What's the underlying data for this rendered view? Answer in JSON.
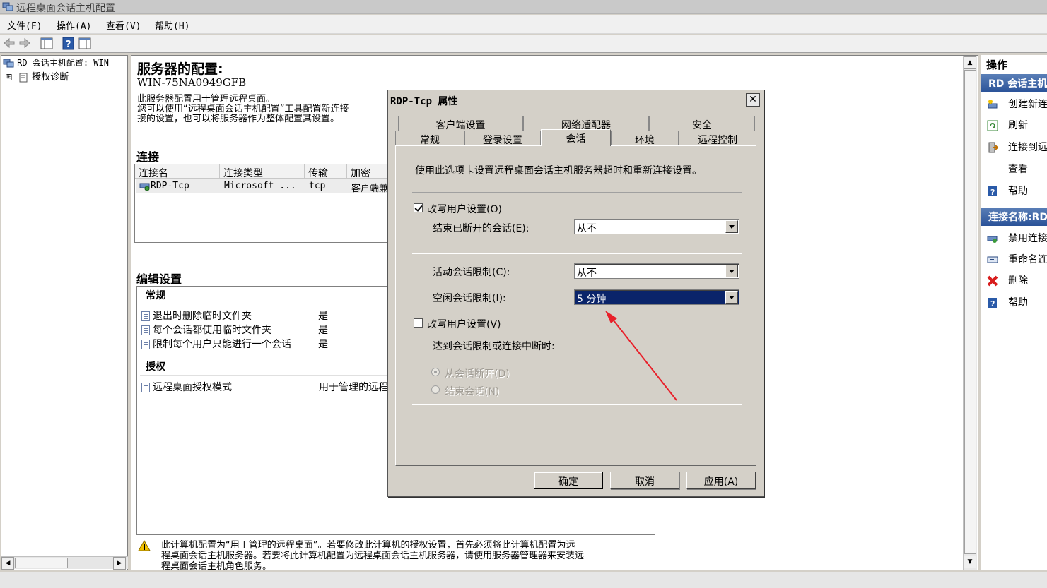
{
  "window": {
    "title": "远程桌面会话主机配置"
  },
  "menu": [
    "文件(F)",
    "操作(A)",
    "查看(V)",
    "帮助(H)"
  ],
  "tree": {
    "root": "RD 会话主机配置: WIN",
    "child": "授权诊断",
    "expander": "⊞"
  },
  "server": {
    "heading": "服务器的配置:",
    "name": "WIN-75NA0949GFB",
    "desc1": "此服务器配置用于管理远程桌面。",
    "desc2": "您可以使用“远程桌面会话主机配置”工具配置新连接",
    "desc3": "接的设置，也可以将服务器作为整体配置其设置。"
  },
  "connections": {
    "heading": "连接",
    "columns": [
      "连接名",
      "连接类型",
      "传输",
      "加密"
    ],
    "rows": [
      {
        "name": "RDP-Tcp",
        "type": "Microsoft ...",
        "transport": "tcp",
        "encryption": "客户端兼"
      }
    ]
  },
  "edit_settings": {
    "heading": "编辑设置",
    "general_heading": "常规",
    "general": [
      {
        "label": "退出时删除临时文件夹",
        "value": "是"
      },
      {
        "label": "每个会话都使用临时文件夹",
        "value": "是"
      },
      {
        "label": "限制每个用户只能进行一个会话",
        "value": "是"
      }
    ],
    "licensing_heading": "授权",
    "licensing": [
      {
        "label": "远程桌面授权模式",
        "value": "用于管理的远程"
      }
    ]
  },
  "warning": {
    "line1": "此计算机配置为“用于管理的远程桌面”。若要修改此计算机的授权设置，首先必须将此计算机配置为远",
    "line2": "程桌面会话主机服务器。若要将此计算机配置为远程桌面会话主机服务器，请使用服务器管理器来安装远",
    "line3": "程桌面会话主机角色服务。"
  },
  "actions": {
    "heading": "操作",
    "group1": "RD 会话主机",
    "items1": [
      "创建新连",
      "刷新",
      "连接到远",
      "查看",
      "帮助"
    ],
    "group2": "连接名称:RD",
    "items2": [
      "禁用连接",
      "重命名连",
      "删除",
      "帮助"
    ]
  },
  "dialog": {
    "title": "RDP-Tcp 属性",
    "close": "✕",
    "tabs_row1": [
      "客户端设置",
      "网络适配器",
      "安全"
    ],
    "tabs_row2": [
      "常规",
      "登录设置",
      "会话",
      "环境",
      "远程控制"
    ],
    "intro": "使用此选项卡设置远程桌面会话主机服务器超时和重新连接设置。",
    "override1_label": "改写用户设置(O)",
    "override1_checked": true,
    "end_disconnected_label": "结束已断开的会话(E):",
    "end_disconnected_value": "从不",
    "active_limit_label": "活动会话限制(C):",
    "active_limit_value": "从不",
    "idle_limit_label": "空闲会话限制(I):",
    "idle_limit_value": "5 分钟",
    "override2_label": "改写用户设置(V)",
    "override2_checked": false,
    "on_limit_label": "达到会话限制或连接中断时:",
    "radio_disconnect": "从会话断开(D)",
    "radio_end": "结束会话(N)",
    "ok": "确定",
    "cancel": "取消",
    "apply": "应用(A)"
  },
  "colors": {
    "selection": "#0a246a",
    "annotation_arrow": "#e8202a",
    "action_header": "#2a5298"
  }
}
